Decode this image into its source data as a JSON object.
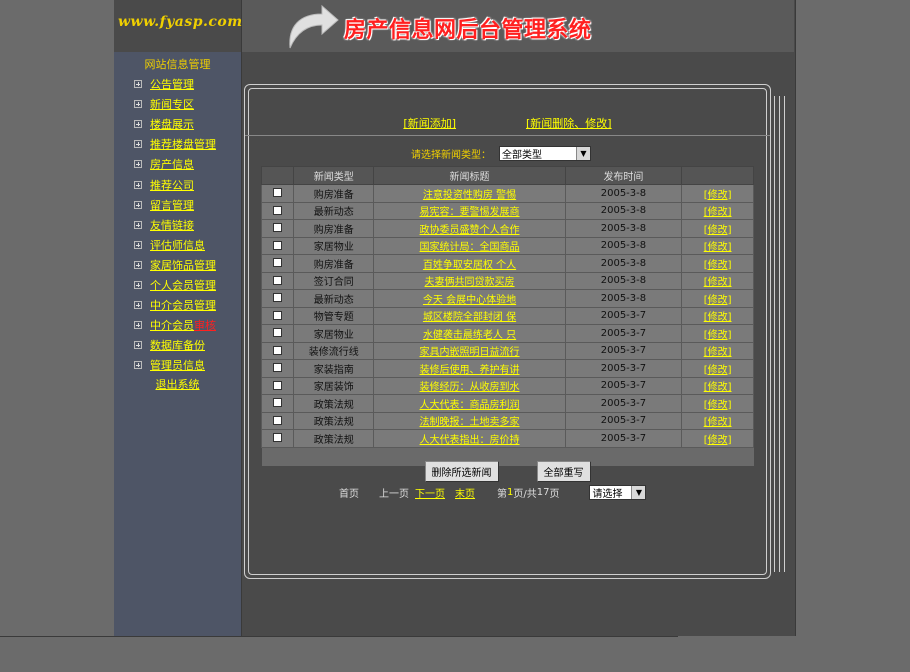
{
  "logo": "www.fyasp.com",
  "system_title": "房产信息网后台管理系统",
  "sidebar": {
    "title": "网站信息管理",
    "items": [
      {
        "label": "公告管理"
      },
      {
        "label": "新闻专区"
      },
      {
        "label": "楼盘展示"
      },
      {
        "label": "推荐楼盘管理"
      },
      {
        "label": "房产信息"
      },
      {
        "label": "推荐公司"
      },
      {
        "label": "留言管理"
      },
      {
        "label": "友情链接"
      },
      {
        "label": "评估师信息"
      },
      {
        "label": "家居饰品管理"
      },
      {
        "label": "个人会员管理"
      },
      {
        "label": "中介会员管理"
      },
      {
        "label": "中介会员",
        "hot": "审核"
      },
      {
        "label": "数据库备份"
      },
      {
        "label": "管理员信息"
      }
    ],
    "logout": "退出系统"
  },
  "top_links": {
    "add": "[新闻添加]",
    "edit": "[新闻删除、修改]"
  },
  "filter": {
    "label": "请选择新闻类型：",
    "selected": "全部类型"
  },
  "table": {
    "headers": [
      "",
      "新闻类型",
      "新闻标题",
      "发布时间",
      ""
    ],
    "rows": [
      {
        "type": "购房准备",
        "title": "注意投资性购房 警惕",
        "date": "2005-3-8",
        "action": "[修改]"
      },
      {
        "type": "最新动态",
        "title": "易宪容：要警惕发展商",
        "date": "2005-3-8",
        "action": "[修改]"
      },
      {
        "type": "购房准备",
        "title": "政协委员盛赞个人合作",
        "date": "2005-3-8",
        "action": "[修改]"
      },
      {
        "type": "家居物业",
        "title": "国家统计局：全国商品",
        "date": "2005-3-8",
        "action": "[修改]"
      },
      {
        "type": "购房准备",
        "title": "百姓争取安居权 个人",
        "date": "2005-3-8",
        "action": "[修改]"
      },
      {
        "type": "签订合同",
        "title": "夫妻俩共同贷款买房",
        "date": "2005-3-8",
        "action": "[修改]"
      },
      {
        "type": "最新动态",
        "title": "今天 会展中心体验地",
        "date": "2005-3-8",
        "action": "[修改]"
      },
      {
        "type": "物管专题",
        "title": "城区楼院全部封闭 保",
        "date": "2005-3-7",
        "action": "[修改]"
      },
      {
        "type": "家居物业",
        "title": "水健袭击晨练老人 只",
        "date": "2005-3-7",
        "action": "[修改]"
      },
      {
        "type": "装修流行线",
        "title": "家具内嵌照明日益流行",
        "date": "2005-3-7",
        "action": "[修改]"
      },
      {
        "type": "家装指南",
        "title": "装修后使用、养护有讲",
        "date": "2005-3-7",
        "action": "[修改]"
      },
      {
        "type": "家居装饰",
        "title": "装修经历：从收房到水",
        "date": "2005-3-7",
        "action": "[修改]"
      },
      {
        "type": "政策法规",
        "title": "人大代表：商品房利润",
        "date": "2005-3-7",
        "action": "[修改]"
      },
      {
        "type": "政策法规",
        "title": "法制晚报：土地卖多家",
        "date": "2005-3-7",
        "action": "[修改]"
      },
      {
        "type": "政策法规",
        "title": "人大代表指出：房价持",
        "date": "2005-3-7",
        "action": "[修改]"
      }
    ]
  },
  "buttons": {
    "delete": "删除所选新闻",
    "reset": "全部重写"
  },
  "pager": {
    "first": "首页",
    "prev": "上一页",
    "next": "下一页",
    "last": "末页",
    "prefix": "第",
    "current": "1",
    "middle": "页/共",
    "total": "17",
    "suffix": "页",
    "select": "请选择"
  },
  "colors": {
    "accent": "#ffff00",
    "title_red": "#ff2020"
  }
}
